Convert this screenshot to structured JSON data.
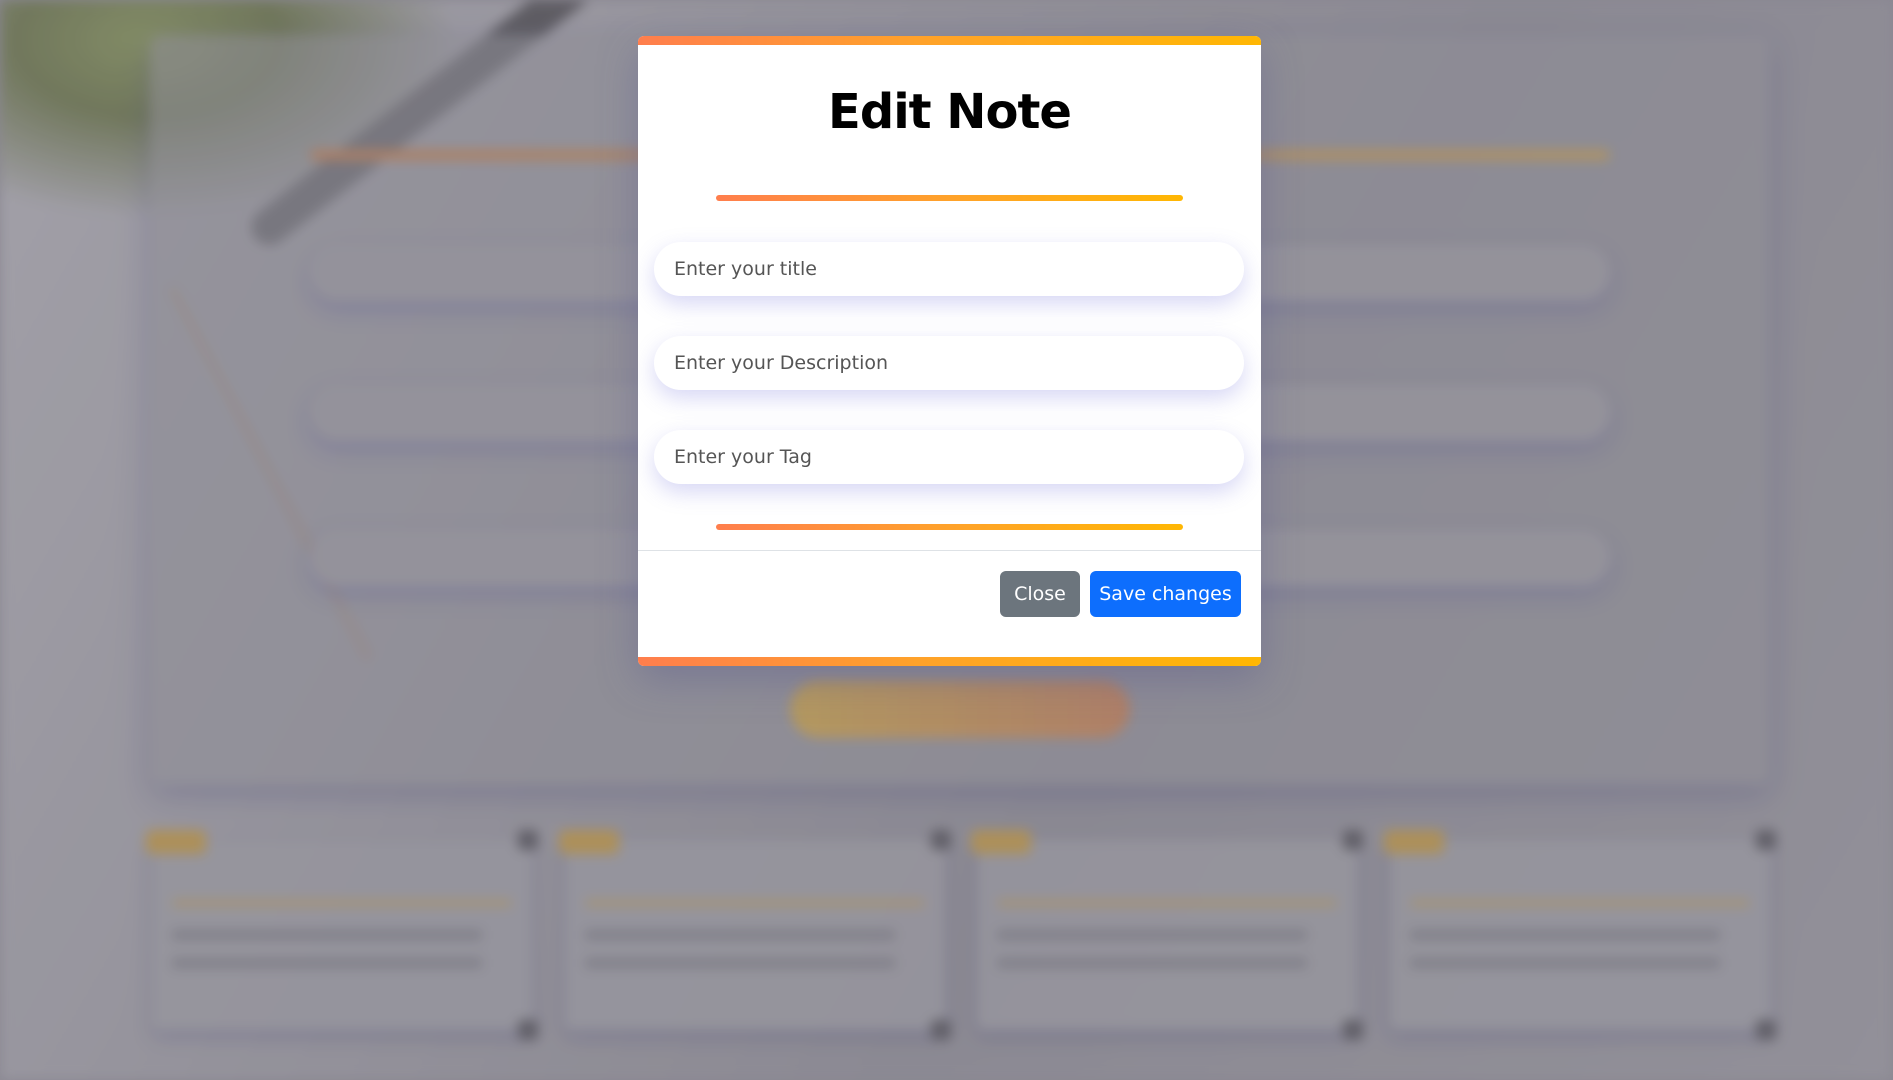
{
  "modal": {
    "title": "Edit Note",
    "fields": {
      "title": {
        "placeholder": "Enter your title",
        "value": ""
      },
      "description": {
        "placeholder": "Enter your Description",
        "value": ""
      },
      "tag": {
        "placeholder": "Enter your Tag",
        "value": ""
      }
    },
    "buttons": {
      "close": "Close",
      "save": "Save changes"
    }
  },
  "colors": {
    "gradient_start": "#ff7e4d",
    "gradient_end": "#ffb703",
    "close_button": "#6c757d",
    "save_button": "#0d6efd"
  }
}
